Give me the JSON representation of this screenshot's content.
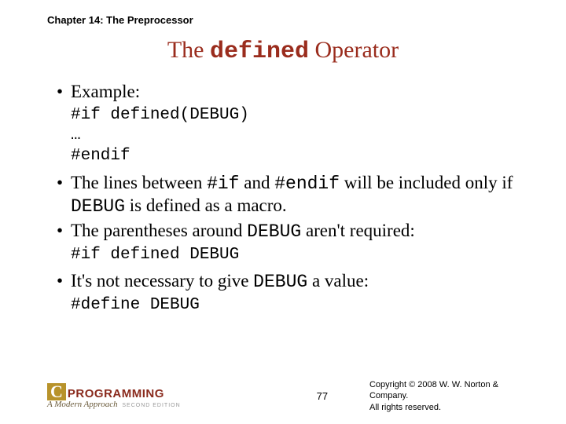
{
  "chapter": "Chapter 14: The Preprocessor",
  "title_prefix": "The ",
  "title_code": "defined",
  "title_suffix": " Operator",
  "bullets": {
    "b1": "Example:",
    "code1": "#if defined(DEBUG)\n…\n#endif",
    "b2_a": "The lines between ",
    "b2_c1": "#if",
    "b2_b": " and ",
    "b2_c2": "#endif",
    "b2_c": " will be included only if ",
    "b2_c3": "DEBUG",
    "b2_d": " is defined as a macro.",
    "b3_a": "The parentheses around ",
    "b3_c1": "DEBUG",
    "b3_b": " aren't required:",
    "code2": "#if defined DEBUG",
    "b4_a": "It's not necessary to give ",
    "b4_c1": "DEBUG",
    "b4_b": " a value:",
    "code3": "#define DEBUG"
  },
  "logo": {
    "c": "C",
    "prog": "PROGRAMMING",
    "sub": "A Modern Approach",
    "ed": "SECOND EDITION"
  },
  "page": "77",
  "copyright1": "Copyright © 2008 W. W. Norton & Company.",
  "copyright2": "All rights reserved."
}
